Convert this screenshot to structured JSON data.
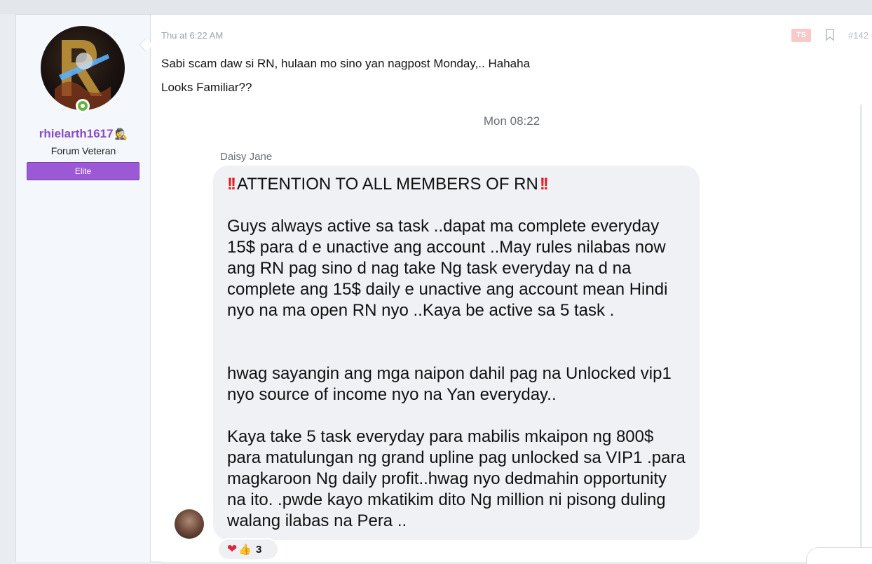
{
  "post": {
    "date": "Thu at 6:22 AM",
    "ts_badge": "TS",
    "post_number": "#142",
    "lines": [
      "Sabi scam daw si RN, hulaan mo sino yan nagpost Monday,.. Hahaha",
      "Looks Familiar??"
    ]
  },
  "user": {
    "name": "rhielarth1617",
    "title": "Forum Veteran",
    "banner": "Elite",
    "status": "online",
    "icons": [
      "incognito-icon",
      "online-status-icon"
    ]
  },
  "screenshot": {
    "time": "Mon 08:22",
    "sender": "Daisy Jane",
    "heading": "ATTENTION TO ALL MEMBERS OF RN",
    "paragraphs": [
      "Guys always active sa task ..dapat ma complete everyday 15$ para d e unactive  ang account ..May rules nilabas now ang RN pag sino d nag take Ng task everyday na d na complete ang 15$ daily e unactive ang account mean Hindi nyo na ma open RN nyo ..Kaya be active sa 5 task .",
      "hwag sayangin ang mga naipon dahil pag na Unlocked vip1 nyo source of income nyo na Yan everyday..",
      "Kaya take 5 task everyday para mabilis mkaipon ng 800$ para matulungan ng grand upline pag unlocked sa VIP1 .para magkaroon Ng daily profit..hwag nyo dedmahin opportunity na ito. .pwde kayo mkatikim dito Ng million ni pisong duling walang ilabas na Pera .."
    ],
    "reaction_count": "3",
    "colors": {
      "bubble": "#eff1f5",
      "accent_username": "#8a4cc2",
      "banner": "#9b59d6"
    }
  }
}
